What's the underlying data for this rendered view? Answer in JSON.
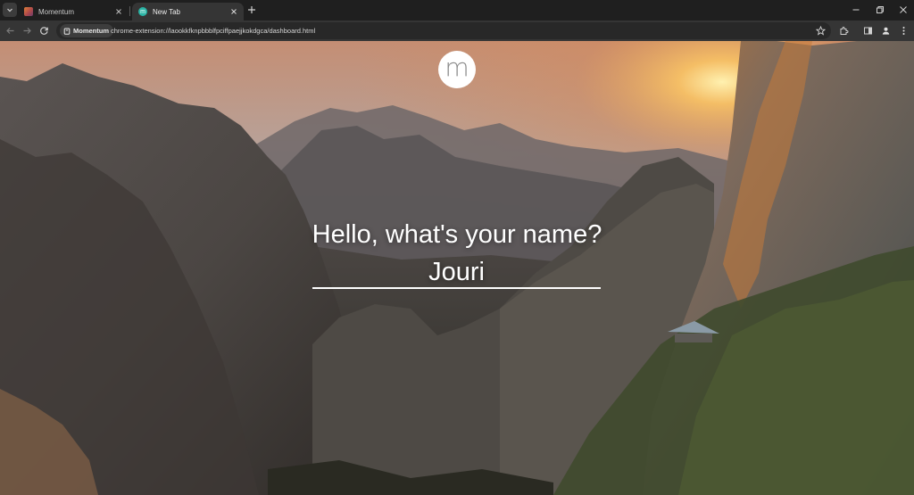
{
  "browser": {
    "tabs": [
      {
        "title": "Momentum",
        "active": false,
        "favicon": "momentum-favicon"
      },
      {
        "title": "New Tab",
        "active": true,
        "favicon": "momentum-m-favicon"
      }
    ],
    "address_bar": {
      "chip_label": "Momentum",
      "url": "chrome-extension://laookkfknpbbblfpciffpaejjkokdgca/dashboard.html"
    },
    "icons": [
      "tab-search-icon",
      "close-icon",
      "new-tab-icon",
      "back-icon",
      "forward-icon",
      "reload-icon",
      "bookmark-star-icon",
      "extensions-icon",
      "side-panel-icon",
      "profile-icon",
      "menu-icon",
      "minimize-icon",
      "maximize-icon",
      "window-close-icon"
    ]
  },
  "dashboard": {
    "logo_letter": "m",
    "question": "Hello, what's your name?",
    "name_input_value": "Jouri"
  },
  "colors": {
    "tabstrip": "#1f1f1f",
    "toolbar": "#353535",
    "omnibox": "#282828",
    "text": "#ffffff",
    "momentum_favicon": "#2bb5a6"
  }
}
